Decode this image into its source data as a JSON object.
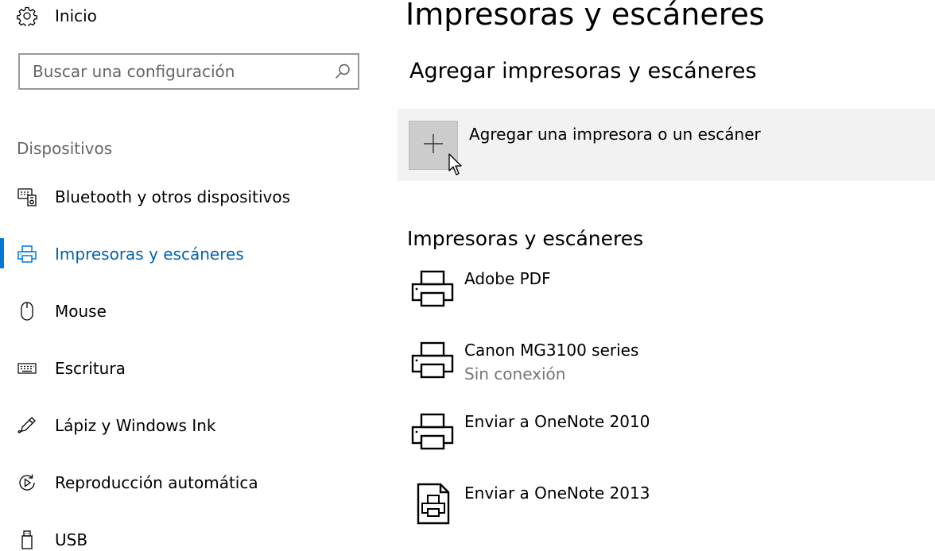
{
  "nav": {
    "home_label": "Inicio",
    "search": {
      "placeholder": "Buscar una configuración",
      "value": ""
    },
    "section_label": "Dispositivos",
    "items": [
      {
        "label": "Bluetooth y otros dispositivos",
        "icon": "bluetooth-devices-icon",
        "selected": false
      },
      {
        "label": "Impresoras y escáneres",
        "icon": "printer-icon",
        "selected": true
      },
      {
        "label": "Mouse",
        "icon": "mouse-icon",
        "selected": false
      },
      {
        "label": "Escritura",
        "icon": "keyboard-icon",
        "selected": false
      },
      {
        "label": "Lápiz y Windows Ink",
        "icon": "pen-icon",
        "selected": false
      },
      {
        "label": "Reproducción automática",
        "icon": "autoplay-icon",
        "selected": false
      },
      {
        "label": "USB",
        "icon": "usb-icon",
        "selected": false
      }
    ]
  },
  "main": {
    "title": "Impresoras y escáneres",
    "add_section": {
      "heading": "Agregar impresoras y escáneres",
      "button_label": "Agregar una impresora o un escáner"
    },
    "list_heading": "Impresoras y escáneres",
    "printers": [
      {
        "name": "Adobe PDF",
        "status": "",
        "icon": "printer-icon"
      },
      {
        "name": "Canon MG3100 series",
        "status": "Sin conexión",
        "icon": "printer-icon"
      },
      {
        "name": "Enviar a OneNote 2010",
        "status": "",
        "icon": "printer-icon"
      },
      {
        "name": "Enviar a OneNote 2013",
        "status": "",
        "icon": "document-printer-icon"
      }
    ]
  },
  "colors": {
    "accent": "#0078d7",
    "selected_text": "#0063b1",
    "secondary_text": "#767676",
    "add_row_bg": "#f2f2f2",
    "add_button_bg": "#cccccc"
  }
}
